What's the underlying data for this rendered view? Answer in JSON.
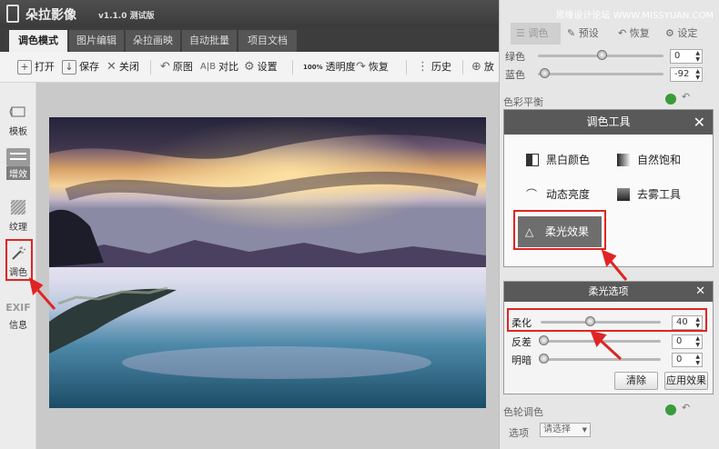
{
  "titlebar": {
    "app_title": "朵拉影像",
    "version": "v1.1.0 测试版",
    "watermark": "思缘设计论坛 WWW.MISSYUAN.COM"
  },
  "tabs": [
    {
      "label": "调色模式",
      "active": true
    },
    {
      "label": "图片编辑",
      "active": false
    },
    {
      "label": "朵拉画映",
      "active": false
    },
    {
      "label": "自动批量",
      "active": false
    },
    {
      "label": "项目文档",
      "active": false
    }
  ],
  "toolbar": {
    "open": "打开",
    "save": "保存",
    "close": "关闭",
    "original": "原图",
    "compare_prefix": "A|B",
    "compare": "对比",
    "settings": "设置",
    "opacity_prefix": "100%",
    "opacity": "透明度",
    "restore": "恢复",
    "history": "历史",
    "zoom": "放"
  },
  "sidebar": {
    "items": [
      {
        "label": "模板",
        "icon": "template-icon"
      },
      {
        "label": "增效",
        "icon": "sliders-icon"
      },
      {
        "label": "纹理",
        "icon": "texture-icon"
      },
      {
        "label": "调色",
        "icon": "magic-wand-icon"
      },
      {
        "label": "EXIF",
        "label2": "信息",
        "icon": "exif-text"
      }
    ]
  },
  "right_panel": {
    "tabs": [
      {
        "label": "调色"
      },
      {
        "label": "预设"
      },
      {
        "label": "恢复"
      },
      {
        "label": "设定"
      }
    ],
    "green_label": "绿色",
    "green_value": "0",
    "blue_label": "蓝色",
    "blue_value": "-92",
    "color_balance": "色彩平衡",
    "color_wheel": "色轮调色",
    "option_label": "选项",
    "option_select": "请选择"
  },
  "tool_dialog": {
    "title": "调色工具",
    "tools": [
      "黑白颜色",
      "自然饱和",
      "动态亮度",
      "去雾工具"
    ],
    "selected_tool": "柔光效果"
  },
  "softlight_dialog": {
    "title": "柔光选项",
    "soften_label": "柔化",
    "soften_value": "40",
    "soften_level": 0.4,
    "contrast_label": "反差",
    "contrast_value": "0",
    "brightness_label": "明暗",
    "brightness_value": "0",
    "clear_button": "清除",
    "apply_button": "应用效果"
  },
  "colors": {
    "highlight": "#e02424",
    "dark": "#595959"
  }
}
